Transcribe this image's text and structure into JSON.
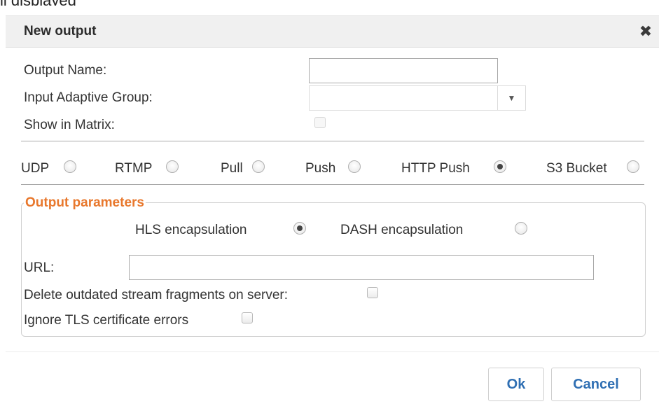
{
  "background": {
    "partial_text": "ll displayed"
  },
  "dialog": {
    "title": "New output",
    "close_glyph": "✖"
  },
  "form": {
    "output_name": {
      "label": "Output Name:",
      "value": ""
    },
    "input_adaptive_group": {
      "label": "Input Adaptive Group:",
      "selected": "",
      "caret": "▼"
    },
    "show_in_matrix": {
      "label": "Show in Matrix:",
      "checked": false,
      "disabled": true
    }
  },
  "output_types": [
    {
      "label": "UDP",
      "selected": false
    },
    {
      "label": "RTMP",
      "selected": false
    },
    {
      "label": "Pull",
      "selected": false
    },
    {
      "label": "Push",
      "selected": false
    },
    {
      "label": "HTTP Push",
      "selected": true
    },
    {
      "label": "S3 Bucket",
      "selected": false
    }
  ],
  "output_parameters": {
    "legend": "Output parameters",
    "encapsulation": [
      {
        "label": "HLS encapsulation",
        "selected": true
      },
      {
        "label": "DASH encapsulation",
        "selected": false
      }
    ],
    "url": {
      "label": "URL:",
      "value": ""
    },
    "delete_outdated": {
      "label": "Delete outdated stream fragments on server:",
      "checked": false
    },
    "ignore_tls": {
      "label": "Ignore TLS certificate errors",
      "checked": false
    }
  },
  "buttons": {
    "ok": "Ok",
    "cancel": "Cancel"
  },
  "colors": {
    "accent_orange": "#e8782d",
    "button_text_blue": "#2f6fb3",
    "titlebar_bg": "#f0f0f0"
  }
}
